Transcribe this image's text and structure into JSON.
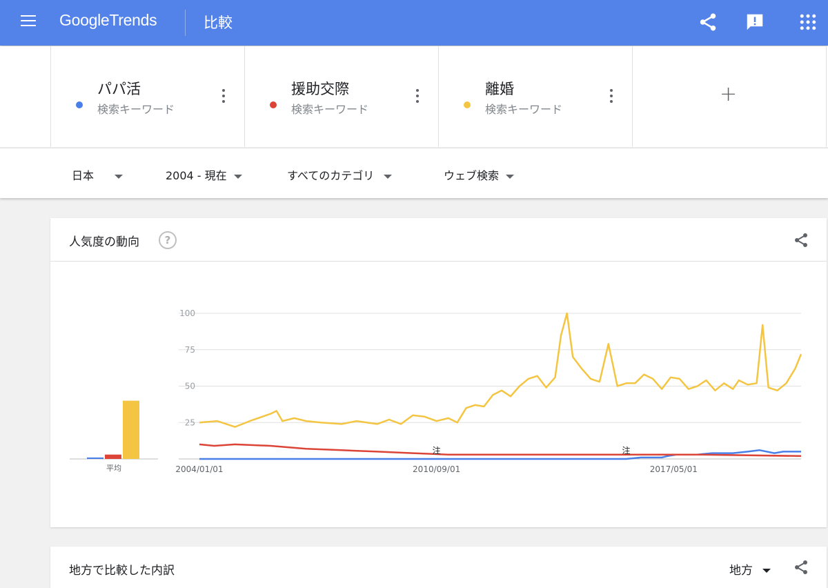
{
  "header": {
    "logo_google": "Google",
    "logo_trends": "Trends",
    "page_title": "比較",
    "icons": [
      "menu-icon",
      "share-icon",
      "feedback-icon",
      "apps-icon"
    ]
  },
  "keywords": [
    {
      "name": "パパ活",
      "type": "検索キーワード",
      "color": "#4a7fe8"
    },
    {
      "name": "援助交際",
      "type": "検索キーワード",
      "color": "#db4437"
    },
    {
      "name": "離婚",
      "type": "検索キーワード",
      "color": "#f4c542"
    }
  ],
  "add_label": "+",
  "filters": {
    "region": "日本",
    "period": "2004 - 現在",
    "category": "すべてのカテゴリ",
    "search_type": "ウェブ検索"
  },
  "trend_card": {
    "title": "人気度の動向",
    "help": "?"
  },
  "region_card": {
    "title": "地方で比較した内訳",
    "region_select": "地方"
  },
  "chart_data": {
    "type": "line",
    "title": "",
    "xlabel": "",
    "ylabel": "",
    "ylim": [
      0,
      100
    ],
    "y_ticks": [
      25,
      50,
      75,
      100
    ],
    "y_tick_labels": [
      "25",
      "50",
      "75",
      "100"
    ],
    "x_range": [
      "2004-01",
      "2020-12"
    ],
    "x_tick_labels": [
      {
        "date": "2004-01",
        "label": "2004/01/01"
      },
      {
        "date": "2010-09",
        "label": "2010/09/01"
      },
      {
        "date": "2017-05",
        "label": "2017/05/01"
      }
    ],
    "annotations": [
      {
        "date": "2010-09",
        "label": "注"
      },
      {
        "date": "2016-01",
        "label": "注"
      }
    ],
    "grid": true,
    "series": [
      {
        "name": "パパ活",
        "color": "#4a7fe8",
        "points": [
          [
            "2004-01",
            0
          ],
          [
            "2016-01",
            0
          ],
          [
            "2016-06",
            1
          ],
          [
            "2017-01",
            1
          ],
          [
            "2017-03",
            2
          ],
          [
            "2017-06",
            3
          ],
          [
            "2018-01",
            3
          ],
          [
            "2018-06",
            4
          ],
          [
            "2019-01",
            4
          ],
          [
            "2019-06",
            5
          ],
          [
            "2019-10",
            6
          ],
          [
            "2020-03",
            4
          ],
          [
            "2020-06",
            5
          ],
          [
            "2020-09",
            5
          ],
          [
            "2020-12",
            5
          ]
        ]
      },
      {
        "name": "援助交際",
        "color": "#db4437",
        "points": [
          [
            "2004-01",
            10
          ],
          [
            "2004-06",
            9
          ],
          [
            "2005-01",
            10
          ],
          [
            "2006-01",
            9
          ],
          [
            "2007-01",
            7
          ],
          [
            "2008-01",
            6
          ],
          [
            "2009-01",
            5
          ],
          [
            "2010-01",
            4
          ],
          [
            "2011-01",
            3
          ],
          [
            "2012-01",
            3
          ],
          [
            "2014-01",
            3
          ],
          [
            "2016-01",
            3
          ],
          [
            "2018-01",
            3
          ],
          [
            "2020-12",
            2
          ]
        ]
      },
      {
        "name": "離婚",
        "color": "#f4c542",
        "points": [
          [
            "2004-01",
            25
          ],
          [
            "2004-07",
            26
          ],
          [
            "2005-01",
            22
          ],
          [
            "2005-06",
            26
          ],
          [
            "2006-01",
            31
          ],
          [
            "2006-03",
            33
          ],
          [
            "2006-05",
            26
          ],
          [
            "2006-09",
            28
          ],
          [
            "2007-01",
            26
          ],
          [
            "2007-06",
            25
          ],
          [
            "2008-01",
            24
          ],
          [
            "2008-06",
            26
          ],
          [
            "2009-01",
            24
          ],
          [
            "2009-05",
            27
          ],
          [
            "2009-09",
            24
          ],
          [
            "2010-01",
            30
          ],
          [
            "2010-05",
            29
          ],
          [
            "2010-09",
            26
          ],
          [
            "2011-01",
            28
          ],
          [
            "2011-04",
            25
          ],
          [
            "2011-07",
            35
          ],
          [
            "2011-10",
            37
          ],
          [
            "2012-01",
            36
          ],
          [
            "2012-04",
            44
          ],
          [
            "2012-07",
            47
          ],
          [
            "2012-10",
            43
          ],
          [
            "2013-01",
            50
          ],
          [
            "2013-04",
            55
          ],
          [
            "2013-07",
            57
          ],
          [
            "2013-10",
            49
          ],
          [
            "2014-01",
            56
          ],
          [
            "2014-03",
            85
          ],
          [
            "2014-05",
            100
          ],
          [
            "2014-07",
            70
          ],
          [
            "2014-10",
            62
          ],
          [
            "2015-01",
            55
          ],
          [
            "2015-04",
            53
          ],
          [
            "2015-07",
            79
          ],
          [
            "2015-10",
            50
          ],
          [
            "2016-01",
            52
          ],
          [
            "2016-04",
            52
          ],
          [
            "2016-07",
            58
          ],
          [
            "2016-10",
            55
          ],
          [
            "2017-01",
            48
          ],
          [
            "2017-04",
            56
          ],
          [
            "2017-07",
            55
          ],
          [
            "2017-10",
            48
          ],
          [
            "2018-01",
            50
          ],
          [
            "2018-04",
            54
          ],
          [
            "2018-07",
            47
          ],
          [
            "2018-10",
            52
          ],
          [
            "2019-01",
            48
          ],
          [
            "2019-03",
            54
          ],
          [
            "2019-06",
            51
          ],
          [
            "2019-09",
            52
          ],
          [
            "2019-11",
            92
          ],
          [
            "2020-01",
            49
          ],
          [
            "2020-04",
            47
          ],
          [
            "2020-07",
            52
          ],
          [
            "2020-10",
            62
          ],
          [
            "2020-12",
            72
          ]
        ]
      }
    ],
    "average_bars": {
      "label": "平均",
      "values": [
        1,
        3,
        40
      ],
      "colors": [
        "#4a7fe8",
        "#db4437",
        "#f4c542"
      ]
    }
  }
}
